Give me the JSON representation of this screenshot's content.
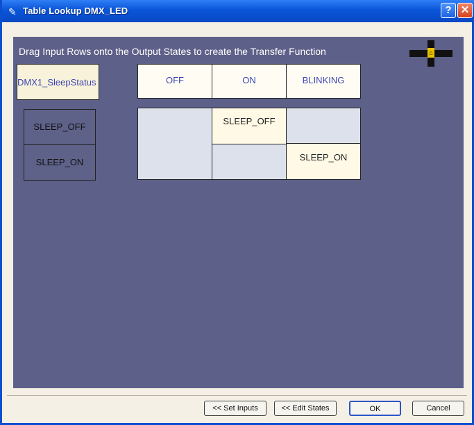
{
  "window": {
    "title": "Table Lookup DMX_LED",
    "help_label": "?",
    "close_label": "✕"
  },
  "instruction": "Drag Input Rows onto the Output States to create the Transfer Function",
  "input_header": "DMX1_SleepStatus",
  "output_states": [
    "OFF",
    "ON",
    "BLINKING"
  ],
  "input_rows": [
    "SLEEP_OFF",
    "SLEEP_ON"
  ],
  "transfer": {
    "on_cell": "SLEEP_OFF",
    "blinking_cell": "SLEEP_ON"
  },
  "buttons": {
    "set_inputs": "<< Set Inputs",
    "edit_states": "<< Edit States",
    "ok": "OK",
    "cancel": "Cancel"
  },
  "colors": {
    "title_bar": "#0a55d8",
    "canvas": "#5d6088",
    "header_text": "#3c44b6"
  }
}
